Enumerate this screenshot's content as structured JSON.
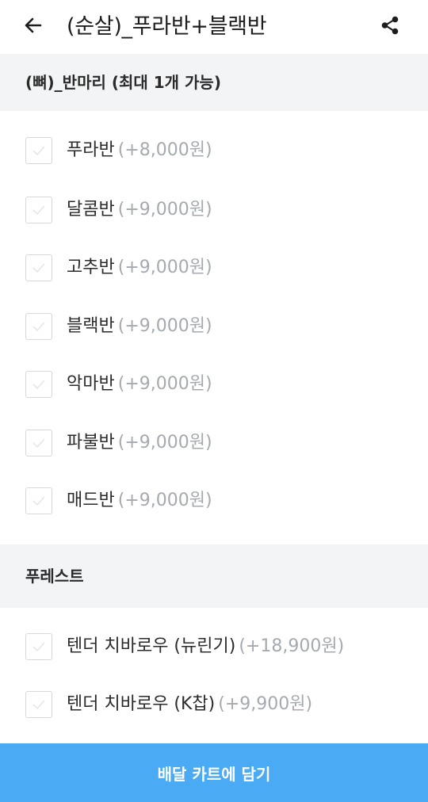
{
  "header": {
    "title": "(순살)_푸라반+블랙반",
    "back_icon": "arrow-left-icon",
    "share_icon": "share-icon"
  },
  "sections": [
    {
      "title": "(뼈)_반마리 (최대 1개 가능)",
      "options": [
        {
          "name": "푸라반",
          "price": "(+8,000원)",
          "checked": false
        },
        {
          "name": "달콤반",
          "price": "(+9,000원)",
          "checked": false
        },
        {
          "name": "고추반",
          "price": "(+9,000원)",
          "checked": false
        },
        {
          "name": "블랙반",
          "price": "(+9,000원)",
          "checked": false
        },
        {
          "name": "악마반",
          "price": "(+9,000원)",
          "checked": false
        },
        {
          "name": "파불반",
          "price": "(+9,000원)",
          "checked": false
        },
        {
          "name": "매드반",
          "price": "(+9,000원)",
          "checked": false
        }
      ]
    },
    {
      "title": "푸레스트",
      "options": [
        {
          "name": "텐더 치바로우 (뉴린기)",
          "price": "(+18,900원)",
          "checked": false
        },
        {
          "name": "텐더 치바로우 (K찹)",
          "price": "(+9,900원)",
          "checked": false
        }
      ]
    }
  ],
  "cart_button": {
    "label": "배달 카트에 담기"
  },
  "colors": {
    "accent": "#4aaaf3",
    "section_bg": "#f3f4f6",
    "price_text": "#a5a9b0",
    "checkbox_border": "#d6d8dc"
  }
}
